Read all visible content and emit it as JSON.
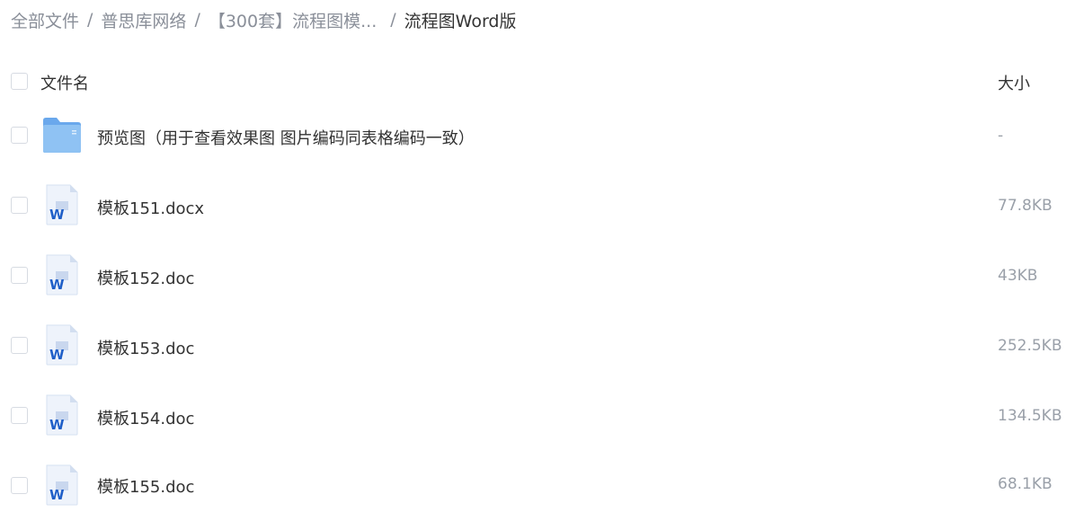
{
  "breadcrumb": {
    "items": [
      "全部文件",
      "普思库网络",
      "【300套】流程图模...",
      "流程图Word版"
    ],
    "separator": "/"
  },
  "header": {
    "select_all": false,
    "name_label": "文件名",
    "size_label": "大小"
  },
  "files": [
    {
      "type": "folder",
      "icon": "folder-icon",
      "name": "预览图（用于查看效果图 图片编码同表格编码一致）",
      "size": "-"
    },
    {
      "type": "word",
      "icon": "word-doc-icon",
      "name": "模板151.docx",
      "size": "77.8KB"
    },
    {
      "type": "word",
      "icon": "word-doc-icon",
      "name": "模板152.doc",
      "size": "43KB"
    },
    {
      "type": "word",
      "icon": "word-doc-icon",
      "name": "模板153.doc",
      "size": "252.5KB"
    },
    {
      "type": "word",
      "icon": "word-doc-icon",
      "name": "模板154.doc",
      "size": "134.5KB"
    },
    {
      "type": "word",
      "icon": "word-doc-icon",
      "name": "模板155.doc",
      "size": "68.1KB"
    }
  ],
  "colors": {
    "folder": "#7fb6f0",
    "word_blue": "#1f5fc8",
    "muted": "#9aa0a9"
  }
}
